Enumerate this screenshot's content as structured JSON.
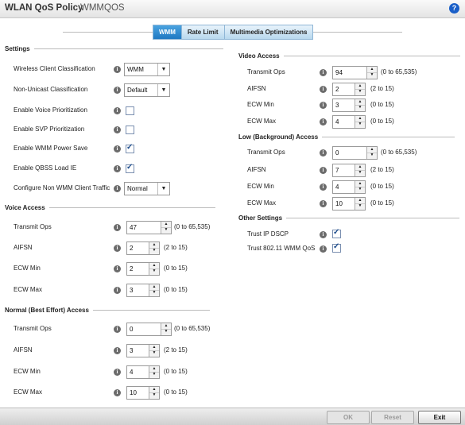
{
  "header": {
    "title": "WLAN QoS Policy",
    "subtitle": "WMMQOS",
    "help_icon": "help-icon"
  },
  "tabs": [
    {
      "label": "WMM",
      "active": true
    },
    {
      "label": "Rate Limit",
      "active": false
    },
    {
      "label": "Multimedia Optimizations",
      "active": false
    }
  ],
  "settings": {
    "title": "Settings",
    "wireless_client_classification": {
      "label": "Wireless Client Classification",
      "value": "WMM"
    },
    "non_unicast_classification": {
      "label": "Non-Unicast Classification",
      "value": "Default"
    },
    "voice_prioritization": {
      "label": "Enable Voice Prioritization",
      "checked": false
    },
    "svp_prioritization": {
      "label": "Enable SVP Prioritization",
      "checked": false
    },
    "wmm_power_save": {
      "label": "Enable WMM Power Save",
      "checked": true
    },
    "qbss_load_ie": {
      "label": "Enable QBSS Load IE",
      "checked": true
    },
    "non_wmm_client_traffic": {
      "label": "Configure Non WMM Client Traffic",
      "value": "Normal"
    }
  },
  "voice_access": {
    "title": "Voice Access",
    "transmit_ops": {
      "label": "Transmit Ops",
      "value": "47",
      "range": "(0 to 65,535)"
    },
    "aifsn": {
      "label": "AIFSN",
      "value": "2",
      "range": "(2 to 15)"
    },
    "ecw_min": {
      "label": "ECW Min",
      "value": "2",
      "range": "(0 to 15)"
    },
    "ecw_max": {
      "label": "ECW Max",
      "value": "3",
      "range": "(0 to 15)"
    }
  },
  "normal_access": {
    "title": "Normal (Best Effort) Access",
    "transmit_ops": {
      "label": "Transmit Ops",
      "value": "0",
      "range": "(0 to 65,535)"
    },
    "aifsn": {
      "label": "AIFSN",
      "value": "3",
      "range": "(2 to 15)"
    },
    "ecw_min": {
      "label": "ECW Min",
      "value": "4",
      "range": "(0 to 15)"
    },
    "ecw_max": {
      "label": "ECW Max",
      "value": "10",
      "range": "(0 to 15)"
    }
  },
  "video_access": {
    "title": "Video Access",
    "transmit_ops": {
      "label": "Transmit Ops",
      "value": "94",
      "range": "(0 to 65,535)"
    },
    "aifsn": {
      "label": "AIFSN",
      "value": "2",
      "range": "(2 to 15)"
    },
    "ecw_min": {
      "label": "ECW Min",
      "value": "3",
      "range": "(0 to 15)"
    },
    "ecw_max": {
      "label": "ECW Max",
      "value": "4",
      "range": "(0 to 15)"
    }
  },
  "low_access": {
    "title": "Low (Background) Access",
    "transmit_ops": {
      "label": "Transmit Ops",
      "value": "0",
      "range": "(0 to 65,535)"
    },
    "aifsn": {
      "label": "AIFSN",
      "value": "7",
      "range": "(2 to 15)"
    },
    "ecw_min": {
      "label": "ECW Min",
      "value": "4",
      "range": "(0 to 15)"
    },
    "ecw_max": {
      "label": "ECW Max",
      "value": "10",
      "range": "(0 to 15)"
    }
  },
  "other_settings": {
    "title": "Other Settings",
    "trust_ip_dscp": {
      "label": "Trust IP DSCP",
      "checked": true
    },
    "trust_wmm_qos": {
      "label": "Trust 802.11 WMM QoS",
      "checked": true
    }
  },
  "footer": {
    "ok_label": "OK",
    "reset_label": "Reset",
    "exit_label": "Exit"
  },
  "icons": {
    "info": "i",
    "dropdown_arrow": "▼",
    "spin_up": "▲",
    "spin_down": "▼",
    "help": "?"
  },
  "colors": {
    "active_tab": "#1e78c2",
    "checkmark": "#1e4d8c",
    "help_icon": "#1a5fc8"
  }
}
